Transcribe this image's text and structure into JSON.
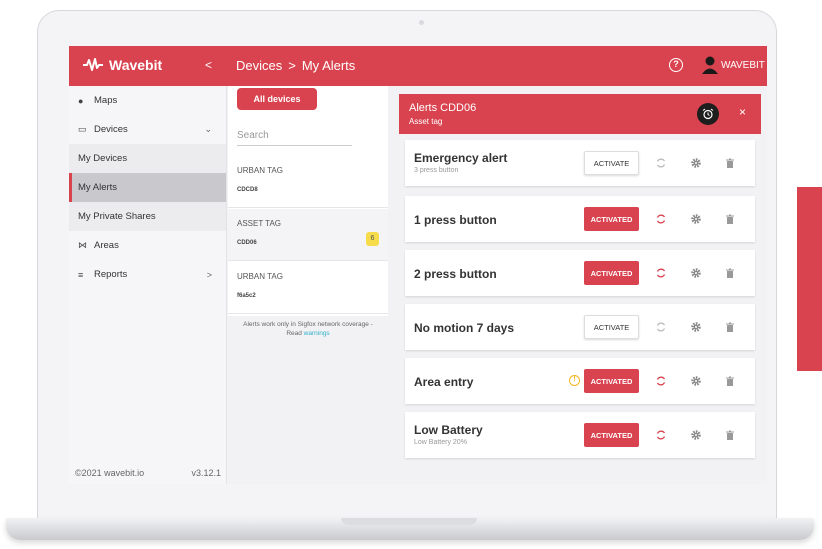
{
  "app": {
    "brand": "Wavebit",
    "collapse": "<"
  },
  "breadcrumb": {
    "section": "Devices",
    "separator": ">",
    "page": "My Alerts"
  },
  "user": {
    "name": "WAVEBIT"
  },
  "sidebar": {
    "items": [
      {
        "label": "Maps",
        "icon": "map-pin-icon"
      },
      {
        "label": "Devices",
        "icon": "devices-icon",
        "chevron": "⌄"
      },
      {
        "label": "My Devices"
      },
      {
        "label": "My Alerts"
      },
      {
        "label": "My Private Shares"
      },
      {
        "label": "Areas",
        "icon": "areas-icon"
      },
      {
        "label": "Reports",
        "icon": "reports-icon",
        "chevron": ">"
      }
    ],
    "footer": {
      "copyright": "©2021 wavebit.io",
      "version": "v3.12.1"
    }
  },
  "devices": {
    "all_button": "All devices",
    "search_placeholder": "Search",
    "items": [
      {
        "type": "URBAN TAG",
        "id": "CDCD8"
      },
      {
        "type": "ASSET TAG",
        "id": "CDD06",
        "badge": "6"
      },
      {
        "type": "URBAN TAG",
        "id": "f6a5c2"
      }
    ],
    "note_prefix": "Alerts work only in Sigfox network coverage -",
    "note_read": "Read",
    "note_link": "warnings"
  },
  "alerts": {
    "title": "Alerts CDD06",
    "subtitle": "Asset tag",
    "close": "×",
    "activate_label": "ACTIVATE",
    "activated_label": "ACTIVATED",
    "items": [
      {
        "title": "Emergency alert",
        "subtitle": "3 press button",
        "state": "ACTIVATE"
      },
      {
        "title": "1 press button",
        "subtitle": "",
        "state": "ACTIVATED"
      },
      {
        "title": "2 press button",
        "subtitle": "",
        "state": "ACTIVATED"
      },
      {
        "title": "No motion 7 days",
        "subtitle": "",
        "state": "ACTIVATE"
      },
      {
        "title": "Area entry",
        "subtitle": "",
        "state": "ACTIVATED",
        "warning": "!"
      },
      {
        "title": "Low Battery",
        "subtitle": "Low Battery 20%",
        "state": "ACTIVATED"
      }
    ]
  },
  "colors": {
    "accent": "#d9434f",
    "badge": "#f6dc4a",
    "warning": "#f2b61f",
    "link": "#2bb0c9"
  }
}
